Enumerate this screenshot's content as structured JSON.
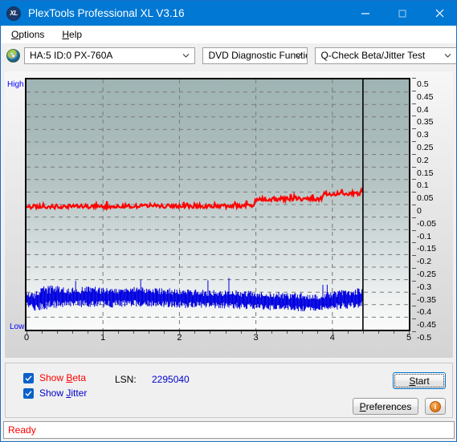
{
  "window": {
    "title": "PlexTools Professional XL V3.16",
    "icon": "xl-badge-icon",
    "minimize_label": "–",
    "maximize_label": "□",
    "close_label": "✕"
  },
  "menu": {
    "items": [
      {
        "label": "Options",
        "mnemonic": "O"
      },
      {
        "label": "Help",
        "mnemonic": "H"
      }
    ]
  },
  "toolbar": {
    "drive_icon": "compact-disc-icon",
    "drive": "HA:5 ID:0  PX-760A",
    "function": "DVD Diagnostic Functions",
    "test": "Q-Check Beta/Jitter Test"
  },
  "chart_labels": {
    "high": "High",
    "low": "Low"
  },
  "controls": {
    "show_beta": "Show Beta",
    "show_beta_mnemonic": "B",
    "show_jitter": "Show Jitter",
    "show_jitter_mnemonic": "J",
    "show_beta_checked": true,
    "show_jitter_checked": true,
    "lsn_label": "LSN:",
    "lsn_value": "2295040",
    "start_label": "Start",
    "start_mnemonic": "S",
    "preferences_label": "Preferences",
    "preferences_mnemonic": "P",
    "info_label": "i"
  },
  "statusbar": {
    "text": "Ready"
  },
  "colors": {
    "titlebar": "#0078d4",
    "beta_trace": "#ff0000",
    "jitter_trace": "#0000e0",
    "accent_blue": "#0b61c8",
    "status_text": "#ff0000",
    "axis_label": "#0000ff"
  },
  "chart_data": {
    "type": "line",
    "title": "Q-Check Beta/Jitter Test",
    "xlabel": "",
    "ylabel": "",
    "xlim": [
      0,
      5
    ],
    "ylim": [
      -0.5,
      0.5
    ],
    "grid": true,
    "legend_position": "below-plot",
    "xticks": [
      0,
      1,
      2,
      3,
      4,
      5
    ],
    "yticks": [
      0.5,
      0.45,
      0.4,
      0.35,
      0.3,
      0.25,
      0.2,
      0.15,
      0.1,
      0.05,
      0,
      -0.05,
      -0.1,
      -0.15,
      -0.2,
      -0.25,
      -0.3,
      -0.35,
      -0.4,
      -0.45,
      -0.5
    ],
    "data_end_marker_x": 4.4,
    "series": [
      {
        "name": "Show Beta",
        "color": "#ff0000",
        "style": "step-noise",
        "noise_amplitude": 0.008,
        "points": [
          {
            "x": 0.0,
            "y": -0.008
          },
          {
            "x": 0.3,
            "y": -0.008
          },
          {
            "x": 0.7,
            "y": -0.007
          },
          {
            "x": 1.1,
            "y": -0.007
          },
          {
            "x": 1.5,
            "y": -0.006
          },
          {
            "x": 1.9,
            "y": -0.006
          },
          {
            "x": 2.3,
            "y": -0.006
          },
          {
            "x": 2.7,
            "y": -0.006
          },
          {
            "x": 2.98,
            "y": -0.006
          },
          {
            "x": 3.0,
            "y": 0.022
          },
          {
            "x": 3.3,
            "y": 0.022
          },
          {
            "x": 3.6,
            "y": 0.023
          },
          {
            "x": 3.85,
            "y": 0.023
          },
          {
            "x": 3.9,
            "y": 0.043
          },
          {
            "x": 4.1,
            "y": 0.044
          },
          {
            "x": 4.25,
            "y": 0.045
          },
          {
            "x": 4.4,
            "y": 0.046
          }
        ]
      },
      {
        "name": "Show Jitter",
        "color": "#0000e0",
        "style": "dense-noise-band",
        "band": [
          {
            "x": 0.0,
            "low": -0.405,
            "high": -0.345
          },
          {
            "x": 0.1,
            "low": -0.425,
            "high": -0.355
          },
          {
            "x": 0.2,
            "low": -0.42,
            "high": -0.33
          },
          {
            "x": 0.35,
            "low": -0.41,
            "high": -0.325
          },
          {
            "x": 0.5,
            "low": -0.41,
            "high": -0.335
          },
          {
            "x": 0.7,
            "low": -0.408,
            "high": -0.33
          },
          {
            "x": 0.9,
            "low": -0.405,
            "high": -0.332
          },
          {
            "x": 1.1,
            "low": -0.408,
            "high": -0.335
          },
          {
            "x": 1.3,
            "low": -0.405,
            "high": -0.33
          },
          {
            "x": 1.5,
            "low": -0.405,
            "high": -0.333
          },
          {
            "x": 1.7,
            "low": -0.405,
            "high": -0.335
          },
          {
            "x": 1.9,
            "low": -0.408,
            "high": -0.338
          },
          {
            "x": 2.1,
            "low": -0.41,
            "high": -0.34
          },
          {
            "x": 2.3,
            "low": -0.412,
            "high": -0.342
          },
          {
            "x": 2.5,
            "low": -0.412,
            "high": -0.345
          },
          {
            "x": 2.7,
            "low": -0.415,
            "high": -0.345
          },
          {
            "x": 2.9,
            "low": -0.415,
            "high": -0.348
          },
          {
            "x": 3.0,
            "low": -0.418,
            "high": -0.35
          },
          {
            "x": 3.2,
            "low": -0.42,
            "high": -0.352
          },
          {
            "x": 3.4,
            "low": -0.422,
            "high": -0.355
          },
          {
            "x": 3.6,
            "low": -0.425,
            "high": -0.358
          },
          {
            "x": 3.8,
            "low": -0.425,
            "high": -0.36
          },
          {
            "x": 3.95,
            "low": -0.42,
            "high": -0.352
          },
          {
            "x": 4.1,
            "low": -0.415,
            "high": -0.345
          },
          {
            "x": 4.25,
            "low": -0.412,
            "high": -0.34
          },
          {
            "x": 4.4,
            "low": -0.408,
            "high": -0.33
          }
        ]
      }
    ]
  }
}
